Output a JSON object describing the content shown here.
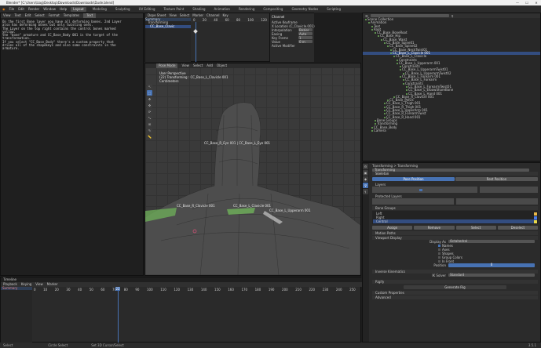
{
  "window": {
    "title": "Blender* [C:\\Users\\Izag\\Desktop\\Downloads\\Downloads\\Dude.blend]",
    "controls": [
      "—",
      "☐",
      "✕"
    ]
  },
  "menubar": {
    "menus": [
      "File",
      "Edit",
      "Render",
      "Window",
      "Help"
    ],
    "workspaces": [
      "Layout",
      "Modeling",
      "Sculpting",
      "UV Editing",
      "Texture Paint",
      "Shading",
      "Animation",
      "Rendering",
      "Compositing",
      "Geometry Nodes",
      "Scripting"
    ],
    "active_workspace": "Layout"
  },
  "text_editor": {
    "header": [
      "View",
      "Text",
      "Edit",
      "Select",
      "Format",
      "Templates"
    ],
    "file": "Text",
    "lines": [
      "On the first Bone layer you have all deforming bones. 2nd Layer",
      "also has deforming bones but only twisting ones.",
      "",
      "The Layer on the top right contains the control bones marked",
      "yellow.",
      "",
      "the \"bone\" armature and CC_Base_Body 001 is the target of the",
      "transformation.",
      "",
      "If you select \"CC_Base_Body\" there's a custom property that",
      "drives all of the shapekeys and also some constraints in the",
      "armature."
    ]
  },
  "dopesheet": {
    "header": [
      "Dope Sheet",
      "View",
      "Select",
      "Marker",
      "Channel",
      "Key"
    ],
    "channels": [
      "Summary",
      "Transforming",
      "CC_Base_Clavic"
    ],
    "frames": [
      "0",
      "20",
      "40",
      "60",
      "80",
      "100",
      "120"
    ]
  },
  "npanel": {
    "title": "Channel",
    "rows": [
      {
        "label": "Active Keyframe",
        "value": ""
      },
      {
        "label": "",
        "value": "X Location (C_Clavicle.001)"
      },
      {
        "label": "Interpolation",
        "value": "Bezier"
      },
      {
        "label": "Easing",
        "value": "Auto"
      },
      {
        "label": "Key Frame",
        "value": "1"
      },
      {
        "label": "Value",
        "value": "0 m"
      },
      {
        "label": "Active Modifier",
        "value": ""
      }
    ]
  },
  "viewport": {
    "header": [
      "Object Mode",
      "View",
      "Select",
      "Add",
      "Object"
    ],
    "mode": "Pose Mode",
    "overlay_lines": [
      "User Perspective",
      "(22) Transforming : CC_Base_L_Clavicle 001",
      "Centimeters"
    ],
    "bone_labels": [
      {
        "text": "CC_Base_R_Eye 001 | CC_Base_L_Eye 001"
      },
      {
        "text": "CC_Base_R_Clavicle 001"
      },
      {
        "text": "CC_Base_L_Clavicle 001"
      },
      {
        "text": "CC_Base_L_Upperarm 001"
      }
    ],
    "tools": [
      "↖",
      "⬚",
      "✥",
      "⟳",
      "⤡",
      "⊞",
      "✎",
      "📏",
      "⊕",
      "▣",
      "☰"
    ]
  },
  "outliner": {
    "search_placeholder": "",
    "lines": [
      {
        "indent": 0,
        "text": "Scene Collection"
      },
      {
        "indent": 1,
        "text": "Animation"
      },
      {
        "indent": 2,
        "text": "Text"
      },
      {
        "indent": 2,
        "text": "Root"
      },
      {
        "indent": 3,
        "text": "CC_Base_BoneRoot"
      },
      {
        "indent": 4,
        "text": "CC_Base_Hip"
      },
      {
        "indent": 5,
        "text": "CC_Base_Waist"
      },
      {
        "indent": 6,
        "text": "CC_Base_Spine01"
      },
      {
        "indent": 7,
        "text": "CC_Base_Spine02"
      },
      {
        "indent": 8,
        "text": "CC_Base_NeckTwist01"
      },
      {
        "indent": 8,
        "text": "CC_Base_L_Clavicle 001",
        "selected": true
      },
      {
        "indent": 9,
        "text": "CC_Base_L_Clavicle"
      },
      {
        "indent": 10,
        "text": "Constraints"
      },
      {
        "indent": 10,
        "text": "CC_Base_L_Upperarm 001"
      },
      {
        "indent": 11,
        "text": "Constraints"
      },
      {
        "indent": 11,
        "text": "CC_Base_L_UpperarmTwist01"
      },
      {
        "indent": 12,
        "text": "CC_Base_L_UpperarmTwist02"
      },
      {
        "indent": 11,
        "text": "CC_Base_L_Forearm 001"
      },
      {
        "indent": 12,
        "text": "CC_Base_L_Forearm"
      },
      {
        "indent": 12,
        "text": "Constraints"
      },
      {
        "indent": 13,
        "text": "CC_Base_L_ForearmTwist01"
      },
      {
        "indent": 13,
        "text": "CC_Base_L_ElbowShareBone"
      },
      {
        "indent": 13,
        "text": "CC_Base_L_Hand 001"
      },
      {
        "indent": 9,
        "text": "CC_Base_R_Clavicle 001"
      },
      {
        "indent": 7,
        "text": "CC_Base_Pelvis"
      },
      {
        "indent": 6,
        "text": "CC_Base_L_Thigh 001"
      },
      {
        "indent": 6,
        "text": "CC_Base_R_Thigh 001"
      },
      {
        "indent": 6,
        "text": "CC_Base_L_UpperArm 001"
      },
      {
        "indent": 6,
        "text": "CC_Base_R_ForearmTwist"
      },
      {
        "indent": 6,
        "text": "CC_Base_R_Hand 001"
      },
      {
        "indent": 3,
        "text": "Bone Groups"
      },
      {
        "indent": 3,
        "text": "Transforming"
      },
      {
        "indent": 2,
        "text": "CC_Base_Body"
      },
      {
        "indent": 2,
        "text": "Camera"
      }
    ]
  },
  "properties": {
    "breadcrumb": "Transforming  >  Transforming",
    "name_field": "Transforming",
    "skeleton_title": "Skeleton",
    "position_label": "Pose Position",
    "rest_label": "Rest Position",
    "layers_title": "Layers",
    "protected_title": "Protected Layers",
    "bone_groups_title": "Bone Groups",
    "groups": [
      {
        "name": "Left",
        "color": "#e8b84a"
      },
      {
        "name": "Right",
        "color": "#4a7ae8"
      },
      {
        "name": "Central",
        "color": "#e8d84a"
      }
    ],
    "group_buttons": [
      "Assign",
      "Remove",
      "Select",
      "Deselect"
    ],
    "motion_paths": "Motion Paths",
    "viewport_display": "Viewport Display",
    "display_as_label": "Display As",
    "display_as_value": "Octahedral",
    "show_label": "Show",
    "show_items": [
      "Names",
      "Axes",
      "Shapes",
      "Group Colors",
      "In Front"
    ],
    "axes_position_label": "Position",
    "axes_position": "0",
    "inverse_kinematics": "Inverse Kinematics",
    "ik_solver_label": "IK Solver",
    "ik_solver_value": "Standard",
    "rigify": "Rigify",
    "rigify_btn": "Generate Rig",
    "custom_props": "Custom Properties",
    "advanced": "Advanced"
  },
  "timeline": {
    "header": [
      "Playback",
      "Keying",
      "View",
      "Marker"
    ],
    "label": "Timeline",
    "channel": "Summary",
    "frames": [
      "0",
      "10",
      "20",
      "30",
      "40",
      "50",
      "60",
      "70",
      "80",
      "90",
      "100",
      "110",
      "120",
      "130",
      "140",
      "150",
      "160",
      "170",
      "180",
      "190",
      "200",
      "210",
      "220",
      "230",
      "240",
      "250"
    ],
    "current_frame": "22"
  },
  "statusbar": {
    "left": "Select",
    "middle": "Circle Select",
    "center": "Set 3D Cursor/Select",
    "right": "3.5.1"
  },
  "colors": {
    "accent": "#4772b3",
    "selected_row": "#334d80",
    "bone_green": "#6fb15a",
    "frame_line": "#4772b3"
  }
}
